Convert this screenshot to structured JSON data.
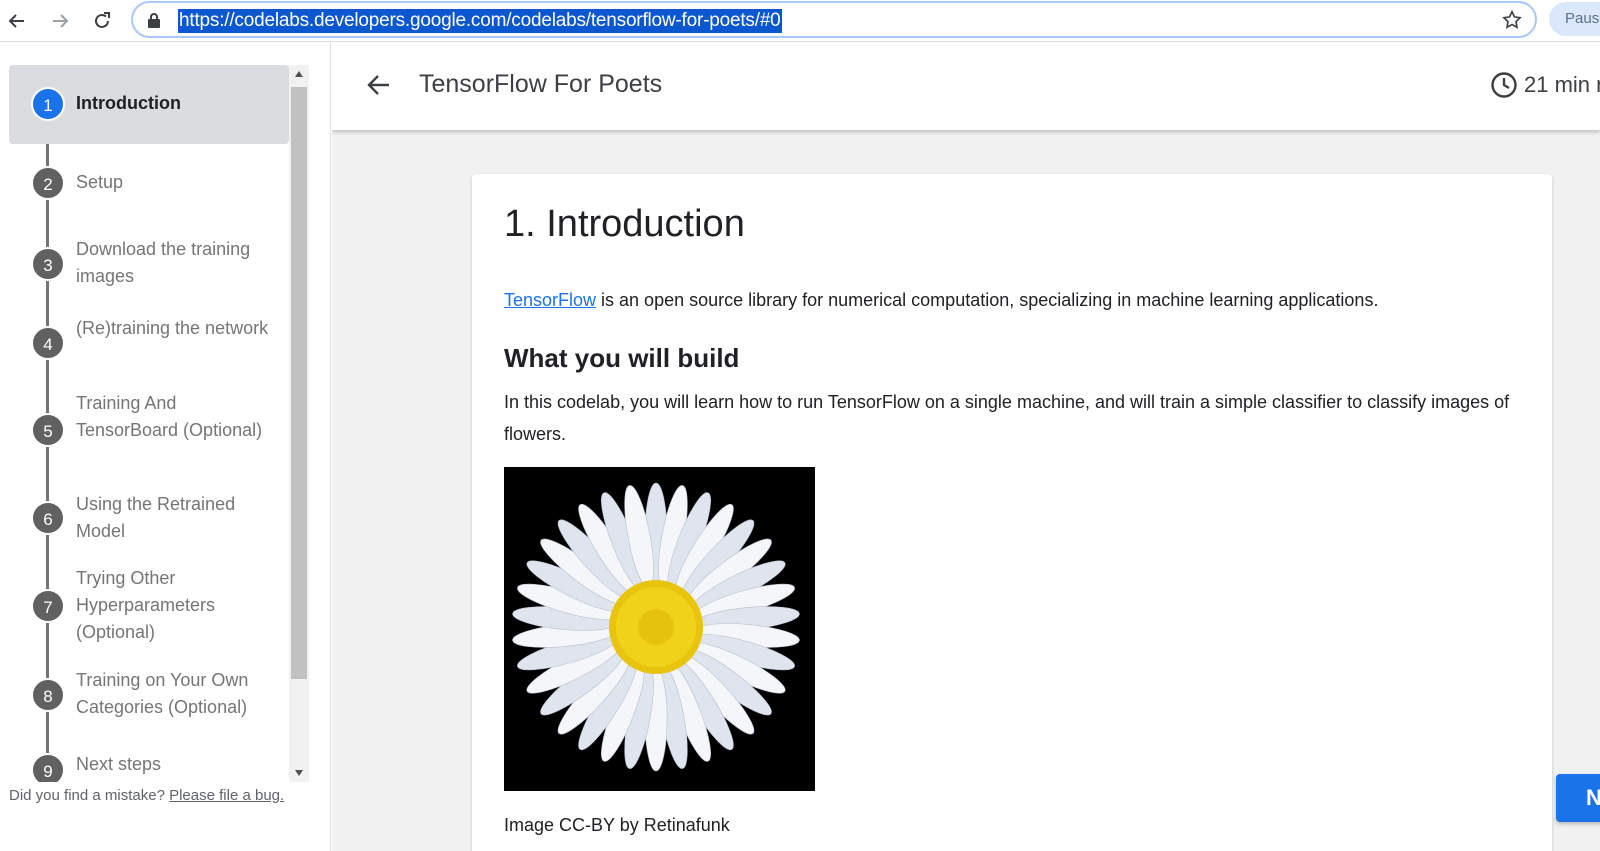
{
  "browser": {
    "url": "https://codelabs.developers.google.com/codelabs/tensorflow-for-poets/#0",
    "profile_label": "Pause",
    "icons": [
      "back-icon",
      "forward-icon",
      "reload-icon",
      "lock-icon",
      "star-icon"
    ]
  },
  "sidebar": {
    "steps": [
      {
        "num": "1",
        "label": "Introduction",
        "active": true
      },
      {
        "num": "2",
        "label": "Setup"
      },
      {
        "num": "3",
        "label": "Download the training images"
      },
      {
        "num": "4",
        "label": "(Re)training the network"
      },
      {
        "num": "5",
        "label": "Training And TensorBoard (Optional)"
      },
      {
        "num": "6",
        "label": "Using the Retrained Model"
      },
      {
        "num": "7",
        "label": "Trying Other Hyperparameters (Optional)"
      },
      {
        "num": "8",
        "label": "Training on Your Own Categories (Optional)"
      },
      {
        "num": "9",
        "label": "Next steps"
      }
    ],
    "bug_text": "Did you find a mistake?",
    "bug_link": "Please file a bug."
  },
  "header": {
    "title": "TensorFlow For Poets",
    "time": "21 min r"
  },
  "content": {
    "heading": "1. Introduction",
    "intro_link": "TensorFlow",
    "intro_rest": " is an open source library for numerical computation, specializing in machine learning applications.",
    "subheading": "What you will build",
    "body": "In this codelab, you will learn how to run TensorFlow on a single machine, and will train a simple classifier to classify images of flowers.",
    "caption": "Image CC-BY by Retinafunk",
    "next_label": "N"
  },
  "colors": {
    "accent": "#1a73e8",
    "selection": "#0b57d0",
    "step_active_bg": "#dadce0",
    "step_inactive": "#616161"
  }
}
